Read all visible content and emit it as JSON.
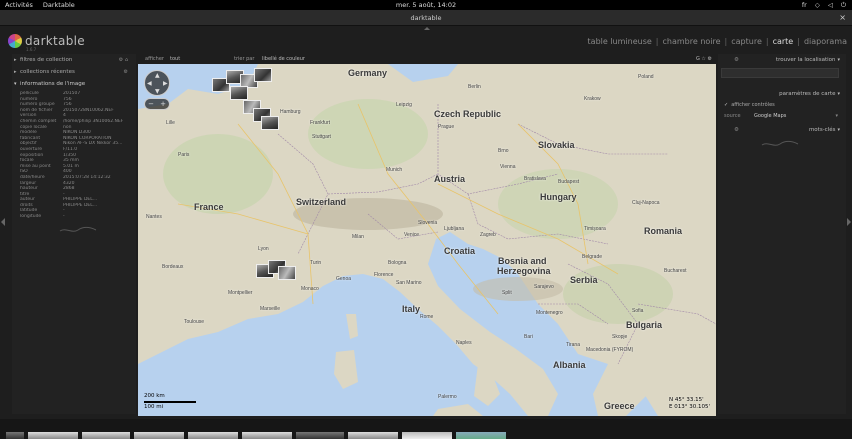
{
  "topbar": {
    "activities": "Activités",
    "app_menu": "Darktable",
    "datetime": "mer. 5 août, 14:02",
    "lang": "fr"
  },
  "window": {
    "title": "darktable",
    "close": "×"
  },
  "logo": {
    "name": "darktable",
    "version": "1.6.7"
  },
  "views": {
    "items": [
      "table lumineuse",
      "chambre noire",
      "capture",
      "carte",
      "diaporama"
    ],
    "active": "carte",
    "separator": "|"
  },
  "left_panel": {
    "sections": [
      {
        "label": "filtres de collection",
        "icons": "⚙ ⌂"
      },
      {
        "label": "collections récentes",
        "icons": "⚙"
      },
      {
        "label": "informations de l'image",
        "icons": ""
      }
    ],
    "info": [
      {
        "key": "pellicule",
        "value": "201507"
      },
      {
        "key": "numéro",
        "value": "756"
      },
      {
        "key": "numéro groupe",
        "value": "756"
      },
      {
        "key": "nom de fichier",
        "value": "20150728N10062.NEF"
      },
      {
        "key": "version",
        "value": "4"
      },
      {
        "key": "chemin complet",
        "value": "/home/philip  3N10062.NEF"
      },
      {
        "key": "copie locale",
        "value": "non"
      },
      {
        "key": "modèle",
        "value": "NIKON D300"
      },
      {
        "key": "fabricant",
        "value": "NIKON CORPORATION"
      },
      {
        "key": "objectif",
        "value": "Nikon AF-S DX Nikkor 35..."
      },
      {
        "key": "ouverture",
        "value": "F/11.0"
      },
      {
        "key": "exposition",
        "value": "1/350"
      },
      {
        "key": "focale",
        "value": "35 mm"
      },
      {
        "key": "mise au point",
        "value": "5.01 m"
      },
      {
        "key": "ISO",
        "value": "400"
      },
      {
        "key": "date/heure",
        "value": "2015:07:28 14:12:32"
      },
      {
        "key": "largeur",
        "value": "4320"
      },
      {
        "key": "hauteur",
        "value": "2868"
      },
      {
        "key": "titre",
        "value": "-"
      },
      {
        "key": "auteur",
        "value": "PHILIPPE DEL..."
      },
      {
        "key": "droits",
        "value": "PHILIPPE DEL..."
      },
      {
        "key": "latitude",
        "value": "-"
      },
      {
        "key": "longitude",
        "value": "-"
      }
    ]
  },
  "toolbar": {
    "afficher": "afficher",
    "afficher_value": "tout",
    "trier": "trier par",
    "trier_value": "libellé de couleur",
    "icons": "G ☆ ⚙"
  },
  "map": {
    "countries": [
      {
        "name": "Germany"
      },
      {
        "name": "Czech Republic"
      },
      {
        "name": "Slovakia"
      },
      {
        "name": "Austria"
      },
      {
        "name": "Hungary"
      },
      {
        "name": "France"
      },
      {
        "name": "Switzerland"
      },
      {
        "name": "Slovenia"
      },
      {
        "name": "Croatia"
      },
      {
        "name": "Romania"
      },
      {
        "name": "Bosnia and"
      },
      {
        "name": "Herzegovina"
      },
      {
        "name": "Serbia"
      },
      {
        "name": "Italy"
      },
      {
        "name": "Bulgaria"
      },
      {
        "name": "Albania"
      },
      {
        "name": "Greece"
      },
      {
        "name": "Monaco"
      },
      {
        "name": "San Marino"
      },
      {
        "name": "Montenegro"
      },
      {
        "name": "Macedonia (FYROM)"
      }
    ],
    "cities": [
      "Hamburg",
      "Berlin",
      "Poland",
      "Krakow",
      "Brno",
      "Munich",
      "Vienna",
      "Budapest",
      "Zagreb",
      "Belgrade",
      "Milan",
      "Venice",
      "Bologna",
      "Florence",
      "Rome",
      "Naples",
      "Marseille",
      "Lyon",
      "Toulouse",
      "Sarajevo",
      "Sofia",
      "Bucharest",
      "Skopje",
      "Tirana",
      "Stuttgart",
      "Frankfurt",
      "Cluj-Napoca",
      "Timișoara",
      "Bratislava",
      "Prague",
      "Leipzig",
      "Lille",
      "Paris",
      "Nantes",
      "Bordeaux",
      "Montpellier",
      "Genoa",
      "Turin",
      "Ljubljana",
      "Split",
      "Bari",
      "Palermo"
    ],
    "scale_km": "200 km",
    "scale_mi": "100 mi",
    "coord_lat": "N 45° 33.15'",
    "coord_lon": "E 013° 30.105'",
    "nav_up": "▲",
    "nav_down": "▼",
    "nav_left": "◀",
    "nav_right": "▶",
    "zoom_out": "−",
    "zoom_in": "+"
  },
  "right_panel": {
    "find_location": "trouver la localisation",
    "map_settings": "paramètres de carte",
    "show_outlines": "afficher contrôles",
    "source_label": "source",
    "source_value": "Google Maps",
    "keywords": "mots-clés"
  },
  "colors": {
    "sea": "#b7d1ee",
    "land": "#dcd7c4",
    "panel": "#222222",
    "accent": "#dddddd"
  }
}
